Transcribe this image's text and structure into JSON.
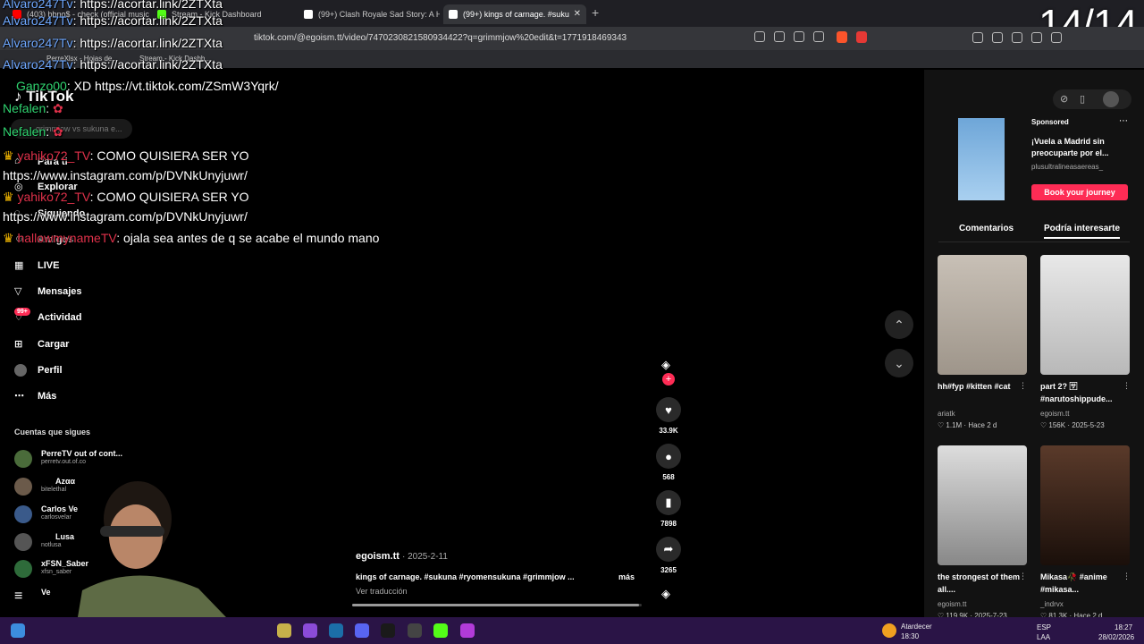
{
  "browser": {
    "tabs": [
      {
        "label": "(403) bbno$ - check (official music v"
      },
      {
        "label": "Stream - Kick Dashboard"
      },
      {
        "label": "(99+) Clash Royale Sad Story: A Heart"
      },
      {
        "label": "(99+) kings of carnage. #suku"
      }
    ],
    "url": "tiktok.com/@egoism.tt/video/7470230821580934422?q=grimmjow%20edit&t=1771918469343",
    "bookmarks": [
      "PerreXlsx - Hojas de...",
      "Stream - Kick Dashb..."
    ],
    "slide_counter": "14/14"
  },
  "sidebar": {
    "logo": "TikTok",
    "search_placeholder": "grimmjow vs sukuna e...",
    "items": [
      {
        "label": "Para ti"
      },
      {
        "label": "Explorar"
      },
      {
        "label": "Siguiendo"
      },
      {
        "label": "Amigos"
      },
      {
        "label": "LIVE"
      },
      {
        "label": "Mensajes"
      },
      {
        "label": "Actividad"
      },
      {
        "label": "Cargar"
      },
      {
        "label": "Perfil"
      },
      {
        "label": "Más"
      }
    ],
    "activity_badge": "99+",
    "following_title": "Cuentas que sigues",
    "following": [
      {
        "name": "PerreTV out of cont...",
        "handle": "perretv.out.of.co"
      },
      {
        "name": "Azαα",
        "handle": "bitelethal"
      },
      {
        "name": "Carlos Ve",
        "handle": "carlosvelar"
      },
      {
        "name": "Lusa",
        "handle": "notlusa"
      },
      {
        "name": "xFSN_Saber",
        "handle": "xfsn_saber"
      },
      {
        "name": "Ve",
        "handle": ""
      }
    ]
  },
  "chat": [
    {
      "user": "Alvaro247Tv",
      "msg": ": https://acortar.link/2ZTXta",
      "color": "blue"
    },
    {
      "user": "Alvaro247Tv",
      "msg": ": https://acortar.link/2ZTXta",
      "color": "blue"
    },
    {
      "user": "Alvaro247Tv",
      "msg": ": https://acortar.link/2ZTXta",
      "color": "blue"
    },
    {
      "user": "Ganzo00",
      "msg": ": XD https://vt.tiktok.com/ZSmW3Yqrk/",
      "color": "green"
    },
    {
      "user": "Nefalen",
      "msg": ":",
      "color": "green"
    },
    {
      "user": "Nefalen",
      "msg": ":",
      "color": "green"
    },
    {
      "user": "yahiko72_TV",
      "msg": ": COMO QUISIERA SER YO",
      "color": "red"
    },
    {
      "user": "",
      "msg": "https://www.instagram.com/p/DVNkUnyjuwr/",
      "color": "white"
    },
    {
      "user": "yahiko72_TV",
      "msg": ": COMO QUISIERA SER YO",
      "color": "red"
    },
    {
      "user": "",
      "msg": "https://www.instagram.com/p/DVNkUnyjuwr/",
      "color": "white"
    },
    {
      "user": "hallowmynameTV",
      "msg": ": ojala sea antes de q se acabe el mundo mano",
      "color": "red"
    }
  ],
  "video": {
    "likes": "33.9K",
    "comments": "568",
    "saves": "7898",
    "shares": "3265",
    "author": "egoism.tt",
    "date": "2025-2-11",
    "description": "kings of carnage. #sukuna #ryomensukuna #grimmjow ...",
    "more": "más",
    "translate": "Ver traducción",
    "progress": 0.99
  },
  "right_panel": {
    "sponsored_label": "Sponsored",
    "ad_title": "¡Vuela a Madrid sin preocuparte por el...",
    "ad_sub": "plusultralineasaereas_",
    "ad_button": "Book your journey",
    "tab_comments": "Comentarios",
    "tab_related": "Podría interesarte",
    "related": [
      {
        "title": "hh#fyp #kitten #cat",
        "author": "ariatk",
        "likes": "1.1M",
        "date": "Hace 2 d"
      },
      {
        "title": "part 2? 🈂 #narutoshippude...",
        "author": "egoism.tt",
        "likes": "156K",
        "date": "2025-5-23"
      },
      {
        "title": "the strongest of them all....",
        "author": "egoism.tt",
        "likes": "119.9K",
        "date": "2025-7-23"
      },
      {
        "title": "Mikasa🥀 #anime #mikasa...",
        "author": "_indrvx",
        "likes": "81.3K",
        "date": "Hace 2 d"
      }
    ]
  },
  "taskbar": {
    "weather_label": "Atardecer",
    "weather_time": "18:30",
    "lang": "ESP",
    "lang2": "LAA",
    "time": "18:27",
    "date": "28/02/2026"
  },
  "colors": {
    "accent": "#fe2c55",
    "taskbar": "#2a1446",
    "chat_blue": "#6fa8ff",
    "chat_green": "#2fd36f",
    "chat_red": "#e0314a"
  }
}
